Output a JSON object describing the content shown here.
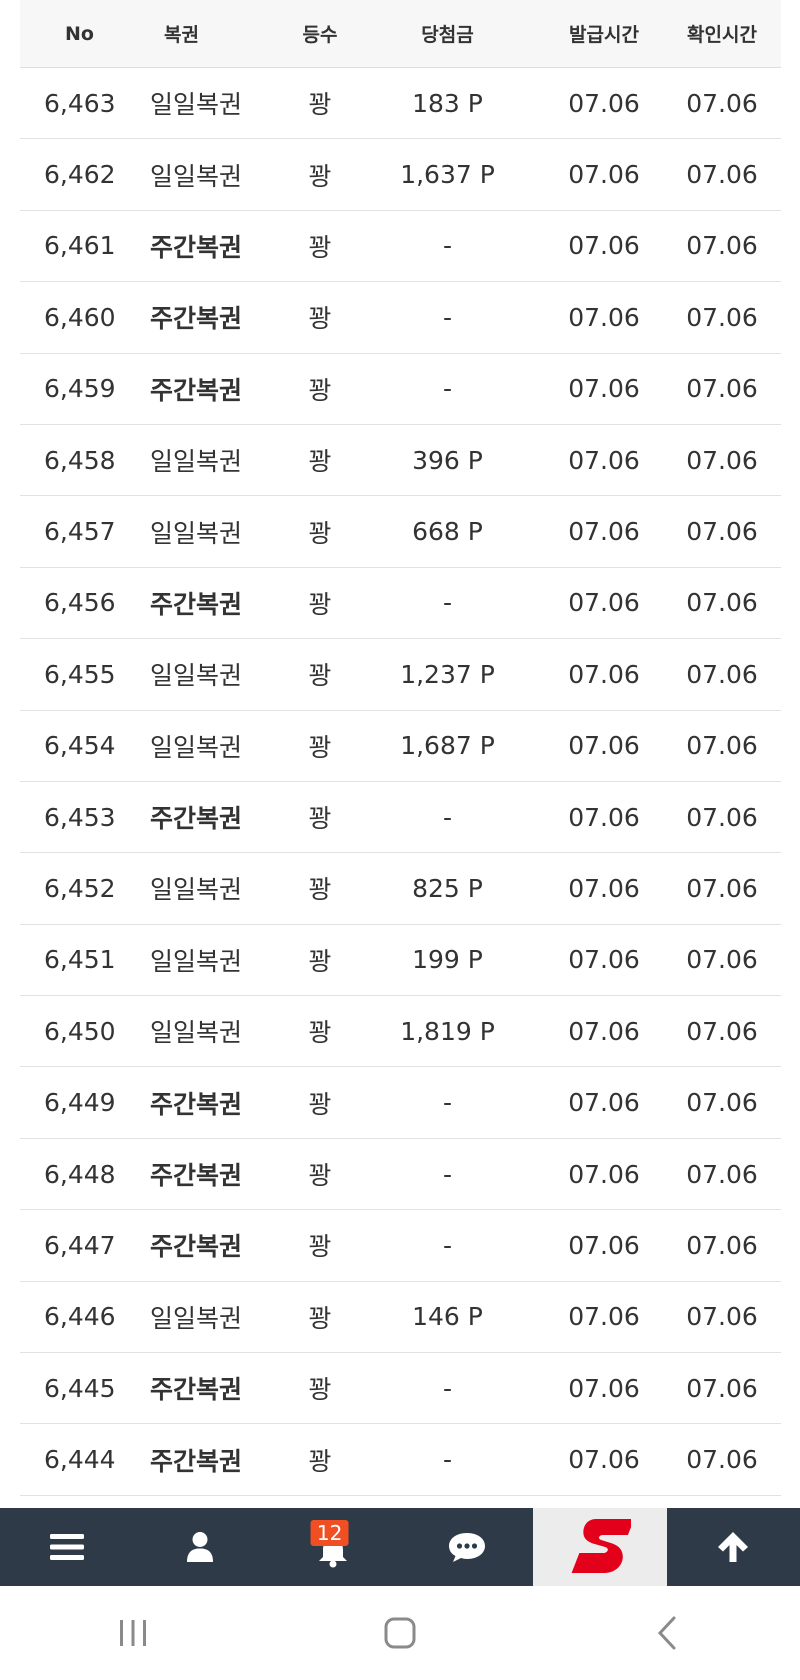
{
  "table": {
    "headers": {
      "no": "No",
      "name": "복권",
      "rank": "등수",
      "prize": "당첨금",
      "issued": "발급시간",
      "checked": "확인시간"
    },
    "rows": [
      {
        "no": "6,463",
        "name": "일일복권",
        "rank": "꽝",
        "prize": "183 P",
        "issued": "07.06",
        "checked": "07.06"
      },
      {
        "no": "6,462",
        "name": "일일복권",
        "rank": "꽝",
        "prize": "1,637 P",
        "issued": "07.06",
        "checked": "07.06"
      },
      {
        "no": "6,461",
        "name": "주간복권",
        "rank": "꽝",
        "prize": "-",
        "issued": "07.06",
        "checked": "07.06"
      },
      {
        "no": "6,460",
        "name": "주간복권",
        "rank": "꽝",
        "prize": "-",
        "issued": "07.06",
        "checked": "07.06"
      },
      {
        "no": "6,459",
        "name": "주간복권",
        "rank": "꽝",
        "prize": "-",
        "issued": "07.06",
        "checked": "07.06"
      },
      {
        "no": "6,458",
        "name": "일일복권",
        "rank": "꽝",
        "prize": "396 P",
        "issued": "07.06",
        "checked": "07.06"
      },
      {
        "no": "6,457",
        "name": "일일복권",
        "rank": "꽝",
        "prize": "668 P",
        "issued": "07.06",
        "checked": "07.06"
      },
      {
        "no": "6,456",
        "name": "주간복권",
        "rank": "꽝",
        "prize": "-",
        "issued": "07.06",
        "checked": "07.06"
      },
      {
        "no": "6,455",
        "name": "일일복권",
        "rank": "꽝",
        "prize": "1,237 P",
        "issued": "07.06",
        "checked": "07.06"
      },
      {
        "no": "6,454",
        "name": "일일복권",
        "rank": "꽝",
        "prize": "1,687 P",
        "issued": "07.06",
        "checked": "07.06"
      },
      {
        "no": "6,453",
        "name": "주간복권",
        "rank": "꽝",
        "prize": "-",
        "issued": "07.06",
        "checked": "07.06"
      },
      {
        "no": "6,452",
        "name": "일일복권",
        "rank": "꽝",
        "prize": "825 P",
        "issued": "07.06",
        "checked": "07.06"
      },
      {
        "no": "6,451",
        "name": "일일복권",
        "rank": "꽝",
        "prize": "199 P",
        "issued": "07.06",
        "checked": "07.06"
      },
      {
        "no": "6,450",
        "name": "일일복권",
        "rank": "꽝",
        "prize": "1,819 P",
        "issued": "07.06",
        "checked": "07.06"
      },
      {
        "no": "6,449",
        "name": "주간복권",
        "rank": "꽝",
        "prize": "-",
        "issued": "07.06",
        "checked": "07.06"
      },
      {
        "no": "6,448",
        "name": "주간복권",
        "rank": "꽝",
        "prize": "-",
        "issued": "07.06",
        "checked": "07.06"
      },
      {
        "no": "6,447",
        "name": "주간복권",
        "rank": "꽝",
        "prize": "-",
        "issued": "07.06",
        "checked": "07.06"
      },
      {
        "no": "6,446",
        "name": "일일복권",
        "rank": "꽝",
        "prize": "146 P",
        "issued": "07.06",
        "checked": "07.06"
      },
      {
        "no": "6,445",
        "name": "주간복권",
        "rank": "꽝",
        "prize": "-",
        "issued": "07.06",
        "checked": "07.06"
      },
      {
        "no": "6,444",
        "name": "주간복권",
        "rank": "꽝",
        "prize": "-",
        "issued": "07.06",
        "checked": "07.06"
      }
    ]
  },
  "bottom_nav": {
    "items": [
      {
        "icon": "menu-icon"
      },
      {
        "icon": "user-icon"
      },
      {
        "icon": "bell-icon",
        "badge": "12"
      },
      {
        "icon": "chat-icon"
      },
      {
        "icon": "logo-s-icon"
      },
      {
        "icon": "arrow-up-icon"
      }
    ],
    "bg_color": "#2f3a48",
    "badge_color": "#f04e23",
    "logo_color": "#e3001b"
  },
  "system_nav": {
    "items": [
      {
        "icon": "recent-apps-icon"
      },
      {
        "icon": "home-icon"
      },
      {
        "icon": "back-icon"
      }
    ]
  }
}
